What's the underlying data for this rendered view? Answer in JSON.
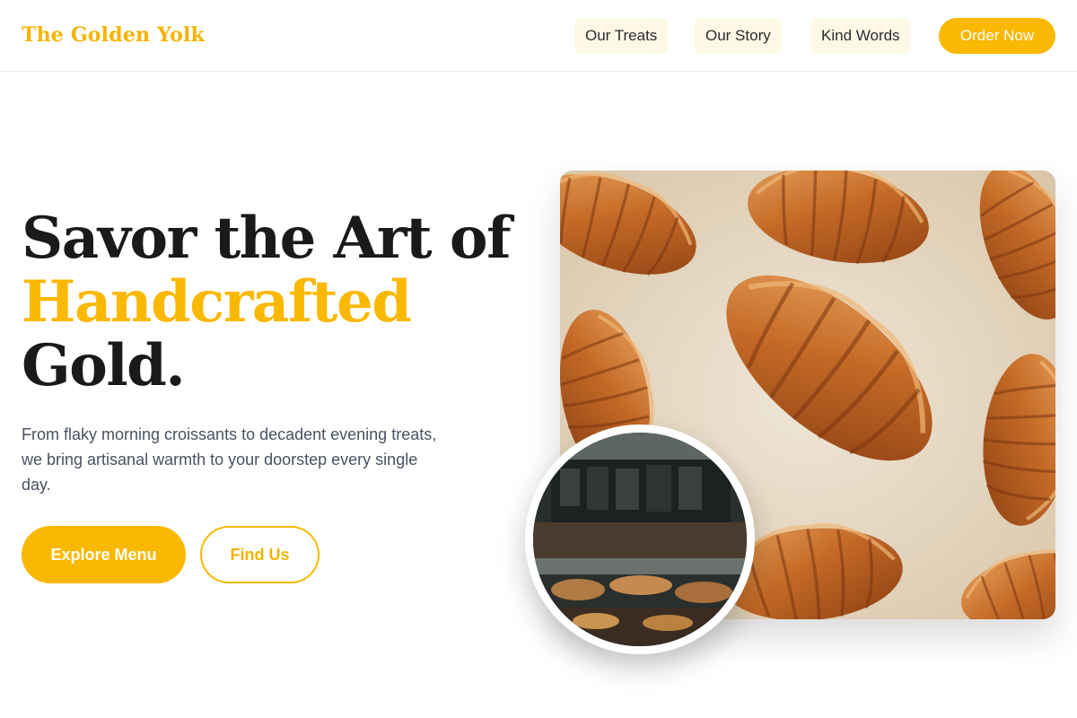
{
  "brand": {
    "name": "The Golden Yolk"
  },
  "nav": {
    "links": [
      "Our Treats",
      "Our Story",
      "Kind Words"
    ],
    "cta": "Order Now"
  },
  "hero": {
    "title_line1": "Savor the Art of",
    "title_accent": "Handcrafted",
    "title_line3": "Gold.",
    "subtitle": "From flaky morning croissants to decadent evening treats, we bring artisanal warmth to your doorstep every single day.",
    "primary_button": "Explore Menu",
    "secondary_button": "Find Us"
  },
  "images": {
    "main": "photo of croissants on baking paper",
    "inset": "photo of a bakery interior with display counter"
  },
  "colors": {
    "accent": "#fbb800",
    "heading": "#1a1a1a",
    "body_text": "#4a5262",
    "nav_bg": "#fff8e6"
  }
}
